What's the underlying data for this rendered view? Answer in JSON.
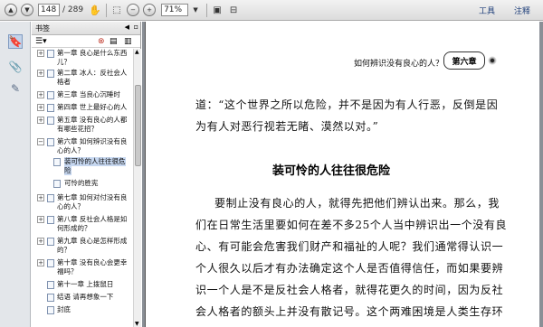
{
  "toolbar": {
    "page_current": "148",
    "page_total": "/ 289",
    "zoom": "71%",
    "tools_label": "工具",
    "comment_label": "注释"
  },
  "panel": {
    "title": "书签",
    "items": [
      {
        "label": "第一章 良心是什么东西",
        "indent": 0,
        "expand": "+"
      },
      {
        "label": "儿？",
        "indent": 0,
        "expand": ""
      },
      {
        "label": "第二章 冰人：反社会人",
        "indent": 0,
        "expand": "+"
      },
      {
        "label": "格者",
        "indent": 0,
        "expand": ""
      },
      {
        "label": "第三章 当良心沉睡时",
        "indent": 0,
        "expand": "+"
      },
      {
        "label": "第四章 世上最好心的人",
        "indent": 0,
        "expand": "+"
      },
      {
        "label": "第五章 没有良心的人都",
        "indent": 0,
        "expand": "+"
      },
      {
        "label": "有哪些花招？",
        "indent": 0,
        "expand": ""
      },
      {
        "label": "第六章 如何辨识没有良",
        "indent": 0,
        "expand": "−"
      },
      {
        "label": "心的人？",
        "indent": 0,
        "expand": ""
      },
      {
        "label": "装可怜的人往往很危",
        "indent": 1,
        "expand": ""
      },
      {
        "label": "险",
        "indent": 1,
        "expand": ""
      },
      {
        "label": "可怜的胜宪",
        "indent": 1,
        "expand": ""
      },
      {
        "label": "第七章 如何对付没有良",
        "indent": 0,
        "expand": "+"
      },
      {
        "label": "心的人？",
        "indent": 0,
        "expand": ""
      },
      {
        "label": "第八章 反社会人格是如",
        "indent": 0,
        "expand": "+"
      },
      {
        "label": "何形成的？",
        "indent": 0,
        "expand": ""
      },
      {
        "label": "第九章 良心是怎样形成",
        "indent": 0,
        "expand": "+"
      },
      {
        "label": "的？",
        "indent": 0,
        "expand": ""
      },
      {
        "label": "第十章 没有良心会更幸",
        "indent": 0,
        "expand": "+"
      },
      {
        "label": "福吗？",
        "indent": 0,
        "expand": ""
      },
      {
        "label": "第十一章 上拨鼠日",
        "indent": 0,
        "expand": ""
      },
      {
        "label": "结语 请再想象一下",
        "indent": 0,
        "expand": ""
      },
      {
        "label": "封底",
        "indent": 0,
        "expand": ""
      }
    ]
  },
  "page": {
    "header_title": "如何辨识没有良心的人？",
    "chapter": "第六章",
    "lines_top": [
      "道：“这个世界之所以危险，并不是因为有人行恶，反倒是因",
      "为有人对恶行视若无睹、漠然以对。”"
    ],
    "section_title": "装可怜的人往往很危险",
    "lines_body": [
      "要制止没有良心的人，就得先把他们辨认出来。那么，我",
      "们在日常生活里要如何在差不多25个人当中辨识出一个没有良",
      "心、有可能会危害我们财产和福祉的人呢？我们通常得认识一",
      "个人很久以后才有办法确定这个人是否值得信任，而如果要辨",
      "识一个人是不是反社会人格者，就得花更久的时间，因为反社",
      "会人格者的额头上并没有散记号。这个两难困境是人类生存环"
    ]
  }
}
